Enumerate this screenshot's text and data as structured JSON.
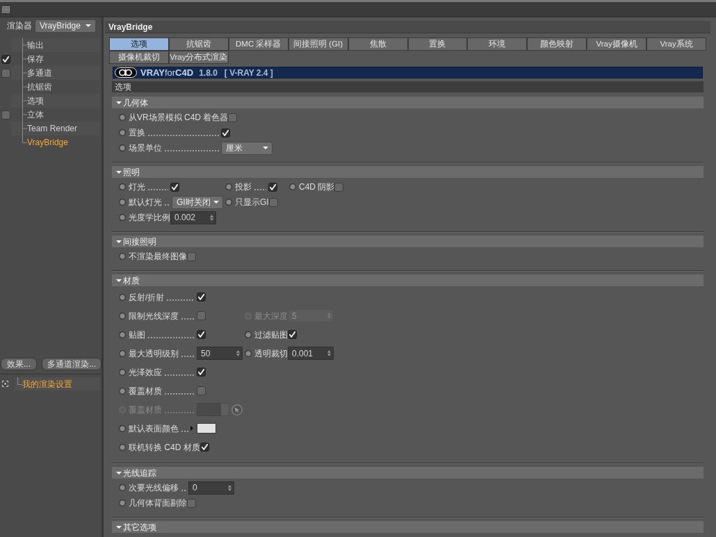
{
  "sidebar": {
    "renderer": {
      "label": "渲染器",
      "value": "VrayBridge"
    },
    "tree": [
      {
        "label": "输出",
        "kind": "plain",
        "selected": false
      },
      {
        "label": "保存",
        "kind": "checkbox",
        "checked": true,
        "selected": false
      },
      {
        "label": "多通道",
        "kind": "checkbox",
        "checked": false,
        "selected": false
      },
      {
        "label": "抗锯齿",
        "kind": "plain",
        "selected": false
      },
      {
        "label": "选项",
        "kind": "plain",
        "selected": false
      },
      {
        "label": "立体",
        "kind": "checkbox",
        "checked": false,
        "selected": false
      },
      {
        "label": "Team Render",
        "kind": "plain",
        "selected": false
      },
      {
        "label": "VrayBridge",
        "kind": "plain",
        "selected": true
      }
    ],
    "buttons": [
      "效果...",
      "多通道渲染..."
    ],
    "render_settings": [
      {
        "label": "我的渲染设置",
        "selected": true
      }
    ]
  },
  "panel": {
    "title": "VrayBridge",
    "tabs": [
      {
        "label": "选项",
        "selected": true
      },
      {
        "label": "抗锯齿",
        "selected": false
      },
      {
        "label": "DMC 采样器",
        "selected": false
      },
      {
        "label": "间接照明 (GI)",
        "selected": false
      },
      {
        "label": "焦散",
        "selected": false
      },
      {
        "label": "置换",
        "selected": false
      },
      {
        "label": "环境",
        "selected": false
      },
      {
        "label": "颜色映射",
        "selected": false
      },
      {
        "label": "Vray摄像机",
        "selected": false
      },
      {
        "label": "Vray系统",
        "selected": false
      },
      {
        "label": "摄像机裁切",
        "selected": false
      },
      {
        "label": "Vray分布式渲染",
        "selected": false
      }
    ],
    "banner": {
      "product": "**VRAY**for**C4D**",
      "version": "1.8.0",
      "engine": "[ V-RAY 2.4 ]"
    },
    "page_title": "选项",
    "sections": [
      {
        "title": "几何体",
        "expanded": true,
        "rows": [
          [
            {
              "kind": "checkbox",
              "label": "从VR场景模拟 C4D 着色器",
              "leader": false,
              "disabled": false,
              "checked": false
            }
          ],
          [
            {
              "kind": "checkbox",
              "label": "置换",
              "leader": true,
              "disabled": false,
              "checked": true
            }
          ],
          [
            {
              "kind": "dropdown",
              "label": "场景单位",
              "leader": true,
              "disabled": false,
              "value": "厘米"
            }
          ]
        ]
      },
      {
        "title": "照明",
        "expanded": true,
        "rows": [
          [
            {
              "kind": "checkbox",
              "label": "灯光",
              "leader": true,
              "disabled": false,
              "checked": true
            },
            {
              "kind": "checkbox",
              "label": "投影",
              "leader": true,
              "disabled": false,
              "checked": true
            },
            {
              "kind": "checkbox",
              "label": "C4D 阴影",
              "leader": false,
              "disabled": false,
              "checked": false
            }
          ],
          [
            {
              "kind": "dropdown",
              "label": "默认灯光",
              "leader": true,
              "disabled": false,
              "value": "GI时关闭"
            },
            {
              "kind": "checkbox",
              "label": "只显示GI",
              "leader": false,
              "disabled": false,
              "checked": false
            }
          ],
          [
            {
              "kind": "number",
              "label": "光度学比例",
              "leader": false,
              "disabled": false,
              "value": "0.002"
            }
          ]
        ]
      },
      {
        "title": "间接照明",
        "expanded": true,
        "rows": [
          [
            {
              "kind": "checkbox",
              "label": "不渲染最终图像",
              "leader": false,
              "disabled": false,
              "checked": false
            }
          ]
        ]
      },
      {
        "title": "材质",
        "expanded": true,
        "rows": [
          [
            {
              "kind": "checkbox",
              "label": "反射/折射",
              "leader": true,
              "disabled": false,
              "checked": true
            }
          ],
          [
            {
              "kind": "checkbox",
              "label": "限制光线深度",
              "leader": true,
              "disabled": false,
              "checked": false
            },
            {
              "kind": "number",
              "label": "最大深度",
              "leader": false,
              "disabled": true,
              "value": "5"
            }
          ],
          [
            {
              "kind": "checkbox",
              "label": "贴图",
              "leader": true,
              "disabled": false,
              "checked": true
            },
            {
              "kind": "checkbox",
              "label": "过滤贴图",
              "leader": false,
              "disabled": false,
              "checked": true
            }
          ],
          [
            {
              "kind": "number",
              "label": "最大透明级别",
              "leader": true,
              "disabled": false,
              "value": "50"
            },
            {
              "kind": "number",
              "label": "透明裁切",
              "leader": false,
              "disabled": false,
              "value": "0.001"
            }
          ],
          [
            {
              "kind": "checkbox",
              "label": "光泽效应",
              "leader": true,
              "disabled": false,
              "checked": true
            }
          ],
          [
            {
              "kind": "checkbox",
              "label": "覆盖材质",
              "leader": true,
              "disabled": false,
              "checked": false
            }
          ],
          [
            {
              "kind": "material",
              "label": "覆盖材质",
              "leader": true,
              "disabled": true
            }
          ],
          [
            {
              "kind": "color",
              "label": "默认表面颜色",
              "leader": true,
              "disabled": false,
              "color": "#e2e2e2"
            }
          ],
          [
            {
              "kind": "checkbox",
              "label": "联机转换 C4D 材质",
              "leader": false,
              "disabled": false,
              "checked": true
            }
          ]
        ]
      },
      {
        "title": "光线追踪",
        "expanded": true,
        "rows": [
          [
            {
              "kind": "number",
              "label": "次要光线偏移",
              "leader": true,
              "disabled": false,
              "value": "0"
            }
          ],
          [
            {
              "kind": "checkbox",
              "label": "几何体背面剔除",
              "leader": false,
              "disabled": false,
              "checked": false
            }
          ]
        ]
      },
      {
        "title": "其它选项",
        "expanded": true
      }
    ]
  }
}
